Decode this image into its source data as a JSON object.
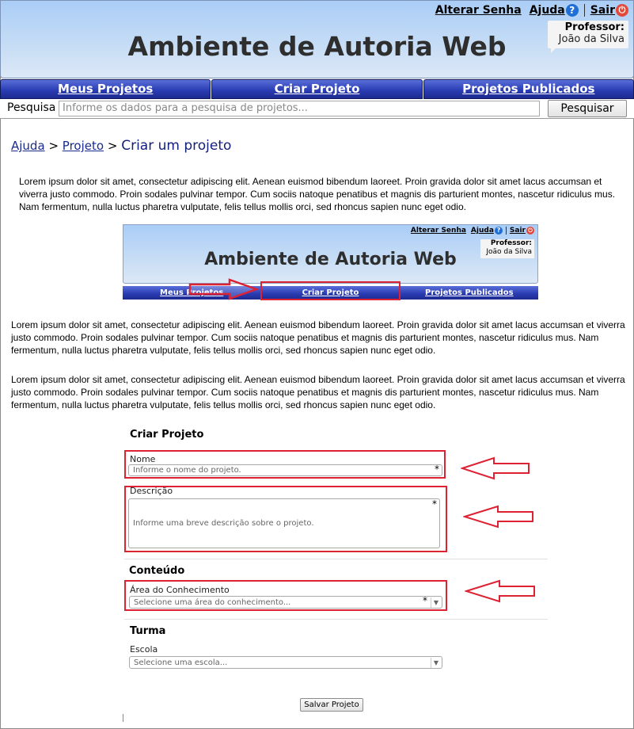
{
  "header": {
    "title": "Ambiente de Autoria Web",
    "links": {
      "change_password": "Alterar Senha",
      "help": "Ajuda",
      "exit": "Sair"
    },
    "user": {
      "role": "Professor:",
      "name": "João da Silva"
    }
  },
  "nav": {
    "tabs": [
      {
        "label": "Meus Projetos"
      },
      {
        "label": "Criar Projeto"
      },
      {
        "label": "Projetos Publicados"
      }
    ]
  },
  "search": {
    "label": "Pesquisa",
    "placeholder": "Informe os dados para a pesquisa de projetos...",
    "button": "Pesquisar"
  },
  "breadcrumb": {
    "items": [
      "Ajuda",
      "Projeto"
    ],
    "separator": ">",
    "current": "Criar um projeto"
  },
  "paragraphs": [
    "Lorem ipsum dolor sit amet, consectetur adipiscing elit. Aenean euismod bibendum laoreet. Proin gravida dolor sit amet lacus accumsan et viverra justo commodo. Proin sodales pulvinar tempor. Cum sociis natoque penatibus et magnis dis parturient montes, nascetur ridiculus mus. Nam fermentum, nulla luctus pharetra vulputate, felis tellus mollis orci, sed rhoncus sapien nunc eget odio.",
    "Lorem ipsum dolor sit amet, consectetur adipiscing elit. Aenean euismod bibendum laoreet. Proin gravida dolor sit amet lacus accumsan et viverra justo commodo. Proin sodales pulvinar tempor. Cum sociis natoque penatibus et magnis dis parturient montes, nascetur ridiculus mus. Nam fermentum, nulla luctus pharetra vulputate, felis tellus mollis orci, sed rhoncus sapien nunc eget odio.",
    "Lorem ipsum dolor sit amet, consectetur adipiscing elit. Aenean euismod bibendum laoreet. Proin gravida dolor sit amet lacus accumsan et viverra justo commodo. Proin sodales pulvinar tempor. Cum sociis natoque penatibus et magnis dis parturient montes, nascetur ridiculus mus. Nam fermentum, nulla luctus pharetra vulputate, felis tellus mollis orci, sed rhoncus sapien nunc eget odio."
  ],
  "thumbnail": {
    "title": "Ambiente de Autoria Web",
    "links": {
      "change_password": "Alterar Senha",
      "help": "Ajuda",
      "exit": "Sair"
    },
    "user": {
      "role": "Professor:",
      "name": "João da Silva"
    },
    "tabs": [
      {
        "label": "Meus Projetos"
      },
      {
        "label": "Criar Projeto"
      },
      {
        "label": "Projetos Publicados"
      }
    ]
  },
  "form": {
    "title": "Criar Projeto",
    "name": {
      "label": "Nome",
      "placeholder": "Informe o nome do projeto."
    },
    "description": {
      "label": "Descrição",
      "placeholder": "Informe uma breve descrição sobre o projeto."
    },
    "content_section": "Conteúdo",
    "knowledge_area": {
      "label": "Área do Conhecimento",
      "placeholder": "Selecione uma área do conhecimento..."
    },
    "class_section": "Turma",
    "school": {
      "label": "Escola",
      "placeholder": "Selecione uma escola..."
    },
    "save_button": "Salvar Projeto",
    "required_mark": "*"
  },
  "colors": {
    "highlight": "#dd2233",
    "nav_blue": "#2b3db4",
    "header_blue": "#aacdf6"
  },
  "icons": {
    "help": "help-circle-icon",
    "exit": "power-icon",
    "dropdown": "chevron-down-icon",
    "annotation": "arrow-left-icon"
  }
}
